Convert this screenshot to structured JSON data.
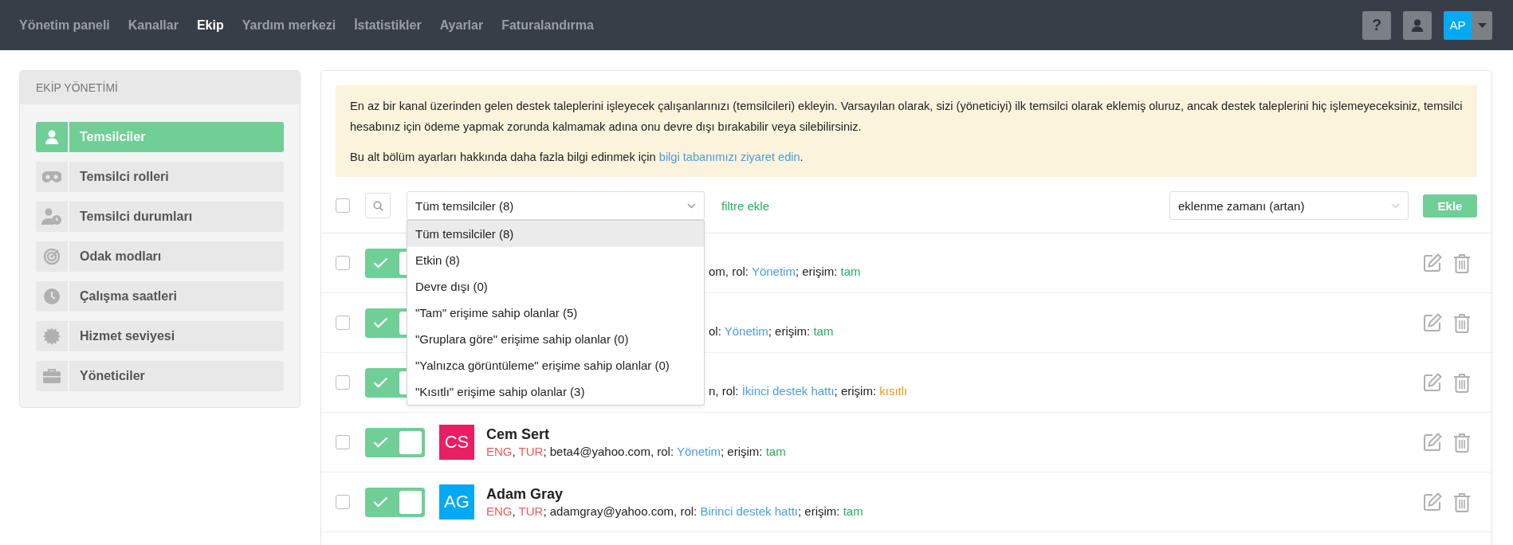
{
  "nav": {
    "items": [
      {
        "label": "Yönetim paneli",
        "selected": false
      },
      {
        "label": "Kanallar",
        "selected": false
      },
      {
        "label": "Ekip",
        "selected": true
      },
      {
        "label": "Yardım merkezi",
        "selected": false
      },
      {
        "label": "İstatistikler",
        "selected": false
      },
      {
        "label": "Ayarlar",
        "selected": false
      },
      {
        "label": "Faturalandırma",
        "selected": false
      }
    ],
    "help_label": "?",
    "account_initials": "AP"
  },
  "sidebar": {
    "title": "EKİP YÖNETİMİ",
    "items": [
      {
        "label": "Temsilciler",
        "selected": true
      },
      {
        "label": "Temsilci rolleri",
        "selected": false
      },
      {
        "label": "Temsilci durumları",
        "selected": false
      },
      {
        "label": "Odak modları",
        "selected": false
      },
      {
        "label": "Çalışma saatleri",
        "selected": false
      },
      {
        "label": "Hizmet seviyesi",
        "selected": false
      },
      {
        "label": "Yöneticiler",
        "selected": false
      }
    ]
  },
  "notice": {
    "text": "En az bir kanal üzerinden gelen destek taleplerini işleyecek çalışanlarınızı (temsilcileri) ekleyin. Varsayılan olarak, sizi (yöneticiyi) ilk temsilci olarak eklemiş oluruz, ancak destek taleplerini hiç işlemeyeceksiniz, temsilci hesabınız için ödeme yapmak zorunda kalmamak adına onu devre dışı bırakabilir veya silebilirsiniz.",
    "more_text": "Bu alt bölüm ayarları hakkında daha fazla bilgi edinmek için ",
    "more_link": "bilgi tabanımızı ziyaret edin",
    "more_end": "."
  },
  "toolbar": {
    "select_all_checked": false,
    "filter": {
      "value": "Tüm temsilciler (8)",
      "expanded": true,
      "options": [
        {
          "label": "Tüm temsilciler (8)",
          "selected": true
        },
        {
          "label": "Etkin (8)",
          "selected": false
        },
        {
          "label": "Devre dışı (0)",
          "selected": false
        },
        {
          "label": "\"Tam\" erişime sahip olanlar (5)",
          "selected": false
        },
        {
          "label": "\"Gruplara göre\" erişime sahip olanlar (0)",
          "selected": false
        },
        {
          "label": "\"Yalnızca görüntüleme\" erişime sahip olanlar (0)",
          "selected": false
        },
        {
          "label": "\"Kısıtlı\" erişime sahip olanlar (3)",
          "selected": false
        }
      ]
    },
    "add_filter": "filtre ekle",
    "sort": {
      "value": "eklenme zamanı (artan)"
    },
    "add_button": "Ekle"
  },
  "agents": [
    {
      "kind": "covered",
      "checked": false,
      "enabled": true,
      "details": [
        {
          "kind": "plain",
          "text": "om, rol: "
        },
        {
          "kind": "role",
          "text": "Yönetim"
        },
        {
          "kind": "plain",
          "text": "; erişim: "
        },
        {
          "kind": "access_full",
          "text": "tam"
        }
      ]
    },
    {
      "kind": "covered",
      "checked": false,
      "enabled": true,
      "details": [
        {
          "kind": "plain",
          "text": "ol: "
        },
        {
          "kind": "role",
          "text": "Yönetim"
        },
        {
          "kind": "plain",
          "text": "; erişim: "
        },
        {
          "kind": "access_full",
          "text": "tam"
        }
      ]
    },
    {
      "kind": "covered",
      "checked": false,
      "enabled": true,
      "details": [
        {
          "kind": "plain",
          "text": "n, rol: "
        },
        {
          "kind": "role",
          "text": "İkinci destek hattı"
        },
        {
          "kind": "plain",
          "text": "; erişim: "
        },
        {
          "kind": "access_restricted",
          "text": "kısıtlı"
        }
      ]
    },
    {
      "kind": "full",
      "checked": false,
      "enabled": true,
      "initials": "CS",
      "color": "#e91e63",
      "name": "Cem Sert",
      "details": [
        {
          "kind": "language",
          "text": "ENG"
        },
        {
          "kind": "plain",
          "text": ", "
        },
        {
          "kind": "language",
          "text": "TUR"
        },
        {
          "kind": "plain",
          "text": "; beta4@yahoo.com, rol: "
        },
        {
          "kind": "role",
          "text": "Yönetim"
        },
        {
          "kind": "plain",
          "text": "; erişim: "
        },
        {
          "kind": "access_full",
          "text": "tam"
        }
      ]
    },
    {
      "kind": "full",
      "checked": false,
      "enabled": true,
      "initials": "AG",
      "color": "#03a9f4",
      "name": "Adam Gray",
      "details": [
        {
          "kind": "language",
          "text": "ENG"
        },
        {
          "kind": "plain",
          "text": ", "
        },
        {
          "kind": "language",
          "text": "TUR"
        },
        {
          "kind": "plain",
          "text": "; adamgray@yahoo.com, rol: "
        },
        {
          "kind": "role",
          "text": "Birinci destek hattı"
        },
        {
          "kind": "plain",
          "text": "; erişim: "
        },
        {
          "kind": "access_full",
          "text": "tam"
        }
      ]
    }
  ]
}
